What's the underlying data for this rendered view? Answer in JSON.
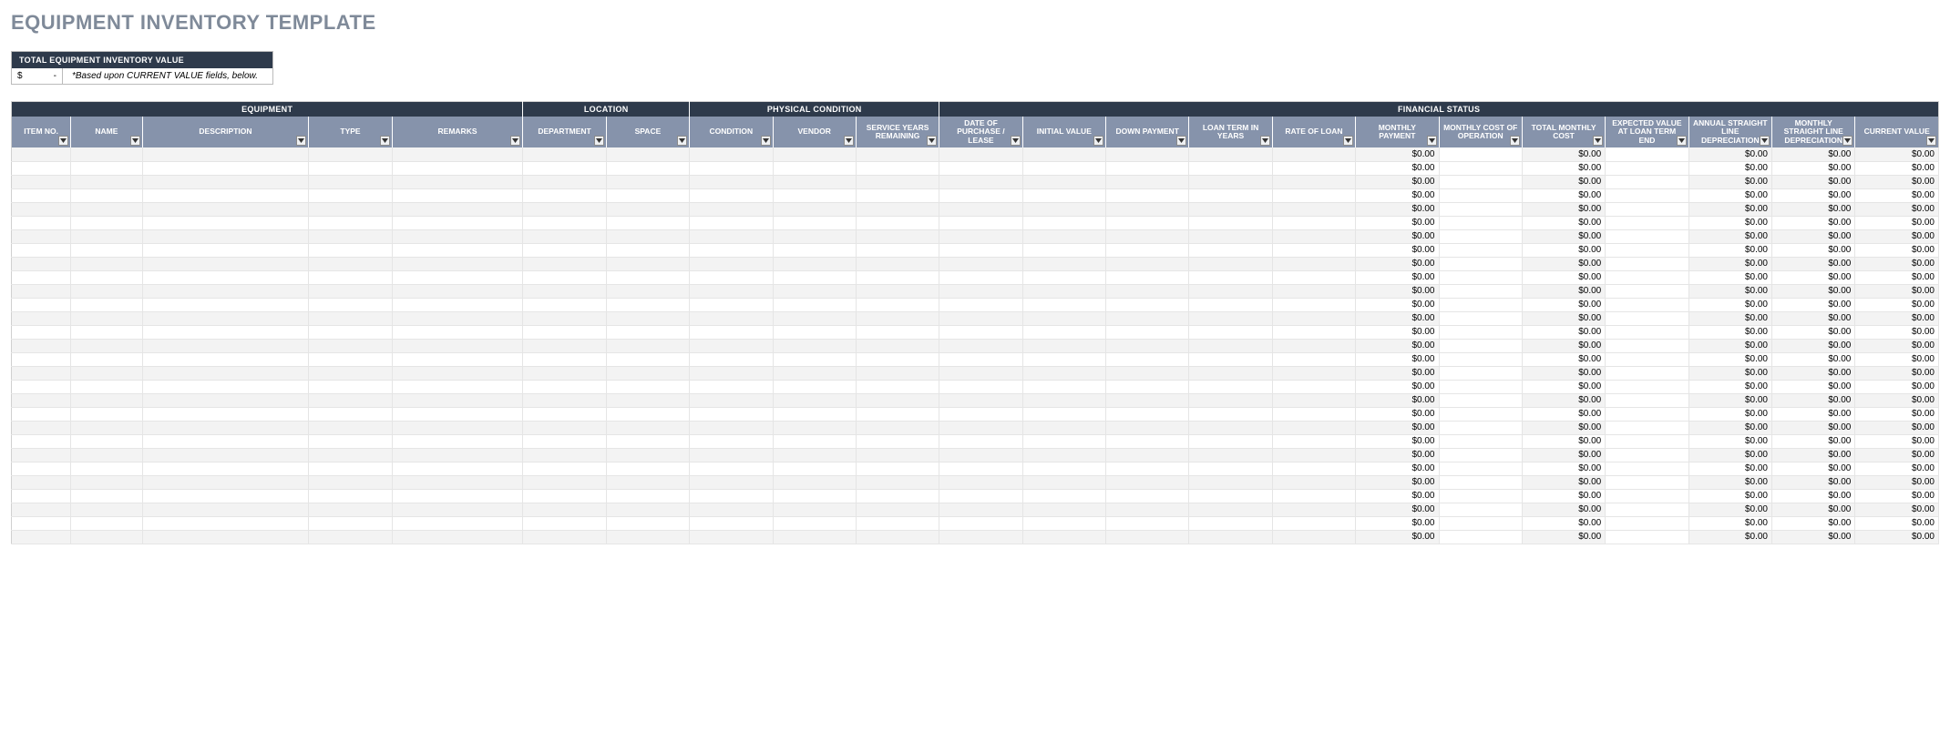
{
  "title": "EQUIPMENT INVENTORY TEMPLATE",
  "summary": {
    "header": "TOTAL EQUIPMENT INVENTORY VALUE",
    "currency": "$",
    "value": "-",
    "note": "*Based upon CURRENT VALUE fields, below."
  },
  "groups": [
    {
      "label": "EQUIPMENT",
      "span": 5
    },
    {
      "label": "LOCATION",
      "span": 2
    },
    {
      "label": "PHYSICAL CONDITION",
      "span": 3
    },
    {
      "label": "FINANCIAL STATUS",
      "span": 12
    }
  ],
  "columns": [
    {
      "label": "ITEM NO."
    },
    {
      "label": "NAME"
    },
    {
      "label": "DESCRIPTION"
    },
    {
      "label": "TYPE"
    },
    {
      "label": "REMARKS"
    },
    {
      "label": "DEPARTMENT"
    },
    {
      "label": "SPACE"
    },
    {
      "label": "CONDITION"
    },
    {
      "label": "VENDOR"
    },
    {
      "label": "SERVICE YEARS REMAINING"
    },
    {
      "label": "DATE OF PURCHASE / LEASE"
    },
    {
      "label": "INITIAL VALUE"
    },
    {
      "label": "DOWN PAYMENT"
    },
    {
      "label": "LOAN TERM IN YEARS"
    },
    {
      "label": "RATE OF LOAN"
    },
    {
      "label": "MONTHLY PAYMENT"
    },
    {
      "label": "MONTHLY COST OF OPERATION"
    },
    {
      "label": "TOTAL MONTHLY COST"
    },
    {
      "label": "EXPECTED VALUE AT LOAN TERM END"
    },
    {
      "label": "ANNUAL STRAIGHT LINE DEPRECIATION"
    },
    {
      "label": "MONTHLY STRAIGHT LINE DEPRECIATION"
    },
    {
      "label": "CURRENT VALUE"
    }
  ],
  "row_count": 29,
  "calc_columns": [
    15,
    17,
    19,
    20,
    21
  ],
  "white_columns": [
    16,
    18
  ],
  "zero_text": "$0.00"
}
